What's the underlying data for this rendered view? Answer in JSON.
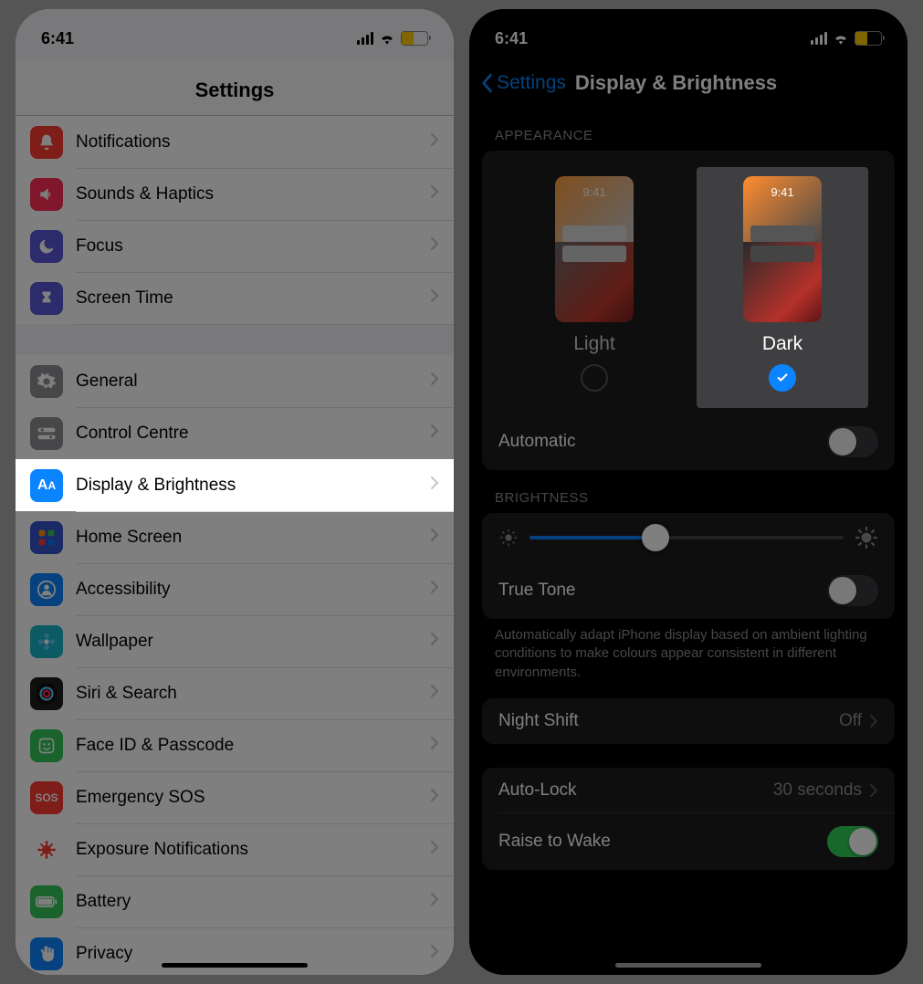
{
  "status": {
    "time": "6:41"
  },
  "left": {
    "title": "Settings",
    "groups": [
      [
        {
          "id": "notifications",
          "label": "Notifications",
          "color": "#ff3b30"
        },
        {
          "id": "sounds",
          "label": "Sounds & Haptics",
          "color": "#ff2d55"
        },
        {
          "id": "focus",
          "label": "Focus",
          "color": "#5856d6"
        },
        {
          "id": "screentime",
          "label": "Screen Time",
          "color": "#5856d6"
        }
      ],
      [
        {
          "id": "general",
          "label": "General",
          "color": "#8e8e93"
        },
        {
          "id": "control",
          "label": "Control Centre",
          "color": "#8e8e93"
        },
        {
          "id": "display",
          "label": "Display & Brightness",
          "color": "#0a84ff",
          "highlight": true
        },
        {
          "id": "home",
          "label": "Home Screen",
          "color": "#3355cc"
        },
        {
          "id": "accessibility",
          "label": "Accessibility",
          "color": "#0a84ff"
        },
        {
          "id": "wallpaper",
          "label": "Wallpaper",
          "color": "#18b5c9"
        },
        {
          "id": "siri",
          "label": "Siri & Search",
          "color": "#1f1f1f"
        },
        {
          "id": "faceid",
          "label": "Face ID & Passcode",
          "color": "#34c759"
        },
        {
          "id": "sos",
          "label": "Emergency SOS",
          "color": "#ff3b30"
        },
        {
          "id": "exposure",
          "label": "Exposure Notifications",
          "color": "#ff3b30"
        },
        {
          "id": "battery",
          "label": "Battery",
          "color": "#34c759"
        },
        {
          "id": "privacy",
          "label": "Privacy",
          "color": "#0a84ff"
        }
      ]
    ]
  },
  "right": {
    "back": "Settings",
    "title": "Display & Brightness",
    "section_appearance": "APPEARANCE",
    "modes": {
      "light": "Light",
      "dark": "Dark",
      "selected": "dark",
      "preview_time": "9:41"
    },
    "automatic": "Automatic",
    "section_brightness": "BRIGHTNESS",
    "true_tone": "True Tone",
    "true_tone_note": "Automatically adapt iPhone display based on ambient lighting conditions to make colours appear consistent in different environments.",
    "night_shift": {
      "label": "Night Shift",
      "value": "Off"
    },
    "auto_lock": {
      "label": "Auto-Lock",
      "value": "30 seconds"
    },
    "raise": "Raise to Wake"
  },
  "icons": {
    "notifications": "bell",
    "sounds": "speaker",
    "focus": "moon",
    "screentime": "hourglass",
    "general": "gear",
    "control": "switches",
    "display": "AA",
    "home": "grid",
    "accessibility": "person",
    "wallpaper": "flower",
    "siri": "siri",
    "faceid": "face",
    "sos": "SOS",
    "exposure": "virus",
    "battery": "battery",
    "privacy": "hand"
  }
}
